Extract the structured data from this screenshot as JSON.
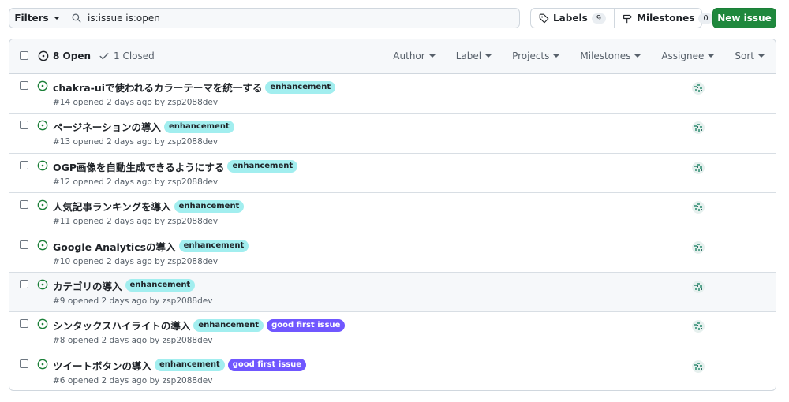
{
  "toolbar": {
    "filters_label": "Filters",
    "search_value": "is:issue is:open",
    "labels_label": "Labels",
    "labels_count": "9",
    "milestones_label": "Milestones",
    "milestones_count": "0",
    "new_issue_label": "New issue"
  },
  "header": {
    "open_label": "8 Open",
    "closed_label": "1 Closed",
    "filters": [
      "Author",
      "Label",
      "Projects",
      "Milestones",
      "Assignee",
      "Sort"
    ]
  },
  "colors": {
    "open_icon": "#1a7f37",
    "enhancement_bg": "#a2eeef",
    "good_first_bg": "#7057ff",
    "primary": "#1f883d"
  },
  "issues": [
    {
      "title": "chakra-uiで使われるカラーテーマを統一する",
      "meta": "#14 opened 2 days ago by zsp2088dev",
      "labels": [
        "enhancement"
      ]
    },
    {
      "title": "ページネーションの導入",
      "meta": "#13 opened 2 days ago by zsp2088dev",
      "labels": [
        "enhancement"
      ]
    },
    {
      "title": "OGP画像を自動生成できるようにする",
      "meta": "#12 opened 2 days ago by zsp2088dev",
      "labels": [
        "enhancement"
      ]
    },
    {
      "title": "人気記事ランキングを導入",
      "meta": "#11 opened 2 days ago by zsp2088dev",
      "labels": [
        "enhancement"
      ]
    },
    {
      "title": "Google Analyticsの導入",
      "meta": "#10 opened 2 days ago by zsp2088dev",
      "labels": [
        "enhancement"
      ]
    },
    {
      "title": "カテゴリの導入",
      "meta": "#9 opened 2 days ago by zsp2088dev",
      "labels": [
        "enhancement"
      ]
    },
    {
      "title": "シンタックスハイライトの導入",
      "meta": "#8 opened 2 days ago by zsp2088dev",
      "labels": [
        "enhancement",
        "good first issue"
      ]
    },
    {
      "title": "ツイートボタンの導入",
      "meta": "#6 opened 2 days ago by zsp2088dev",
      "labels": [
        "enhancement",
        "good first issue"
      ]
    }
  ]
}
